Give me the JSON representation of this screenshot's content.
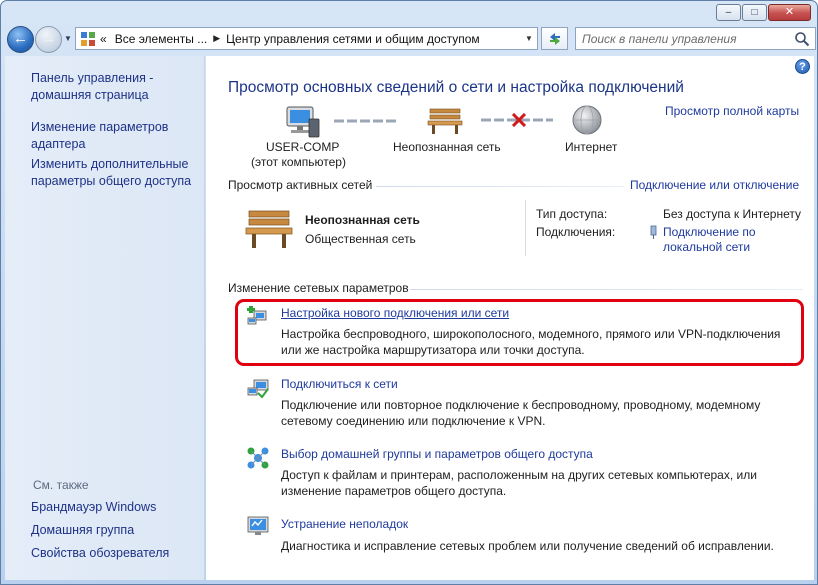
{
  "window": {
    "caption_buttons": {
      "minimize_glyph": "–",
      "maximize_glyph": "□",
      "close_glyph": "✕"
    }
  },
  "nav": {
    "back_glyph": "←",
    "forward_glyph": "→",
    "breadcrumb": [
      "«",
      "Все элементы ...",
      "Центр управления сетями и общим доступом"
    ],
    "search_placeholder": "Поиск в панели управления"
  },
  "sidebar": {
    "links": [
      {
        "label": "Панель управления -\nдомашняя страница"
      },
      {
        "label": "Изменение параметров\nадаптера"
      },
      {
        "label": "Изменить дополнительные\nпараметры общего доступа"
      }
    ],
    "see_also_label": "См. также",
    "see_also": [
      {
        "label": "Брандмауэр Windows"
      },
      {
        "label": "Домашняя группа"
      },
      {
        "label": "Свойства обозревателя"
      }
    ]
  },
  "main": {
    "help_glyph": "?",
    "title": "Просмотр основных сведений о сети и настройка подключений",
    "full_map_link": "Просмотр полной карты",
    "map": {
      "computer_label": "USER-COMP",
      "computer_sub": "(этот компьютер)",
      "network_label": "Неопознанная сеть",
      "internet_label": "Интернет"
    },
    "active": {
      "heading": "Просмотр активных сетей",
      "connect_link": "Подключение или отключение",
      "network_name": "Неопознанная сеть",
      "network_type": "Общественная сеть",
      "access_label": "Тип доступа:",
      "access_value": "Без доступа к Интернету",
      "connections_label": "Подключения:",
      "connection_link": "Подключение по\nлокальной сети"
    },
    "change": {
      "heading": "Изменение сетевых параметров",
      "tasks": [
        {
          "title": "Настройка нового подключения или сети",
          "desc": "Настройка беспроводного, широкополосного, модемного, прямого или VPN-подключения или же настройка маршрутизатора или точки доступа.",
          "icon": "new-connection-icon"
        },
        {
          "title": "Подключиться к сети",
          "desc": "Подключение или повторное подключение к беспроводному, проводному, модемному сетевому соединению или подключение к VPN.",
          "icon": "connect-network-icon"
        },
        {
          "title": "Выбор домашней группы и параметров общего доступа",
          "desc": "Доступ к файлам и принтерам, расположенным на других сетевых компьютерах, или изменение параметров общего доступа.",
          "icon": "homegroup-icon"
        },
        {
          "title": "Устранение неполадок",
          "desc": "Диагностика и исправление сетевых проблем или получение сведений об исправлении.",
          "icon": "troubleshoot-icon"
        }
      ]
    }
  },
  "colors": {
    "link": "#1e3a9d",
    "title": "#1c3487",
    "highlight": "#e0000f",
    "sidebar_bg": "#e4edf8"
  }
}
